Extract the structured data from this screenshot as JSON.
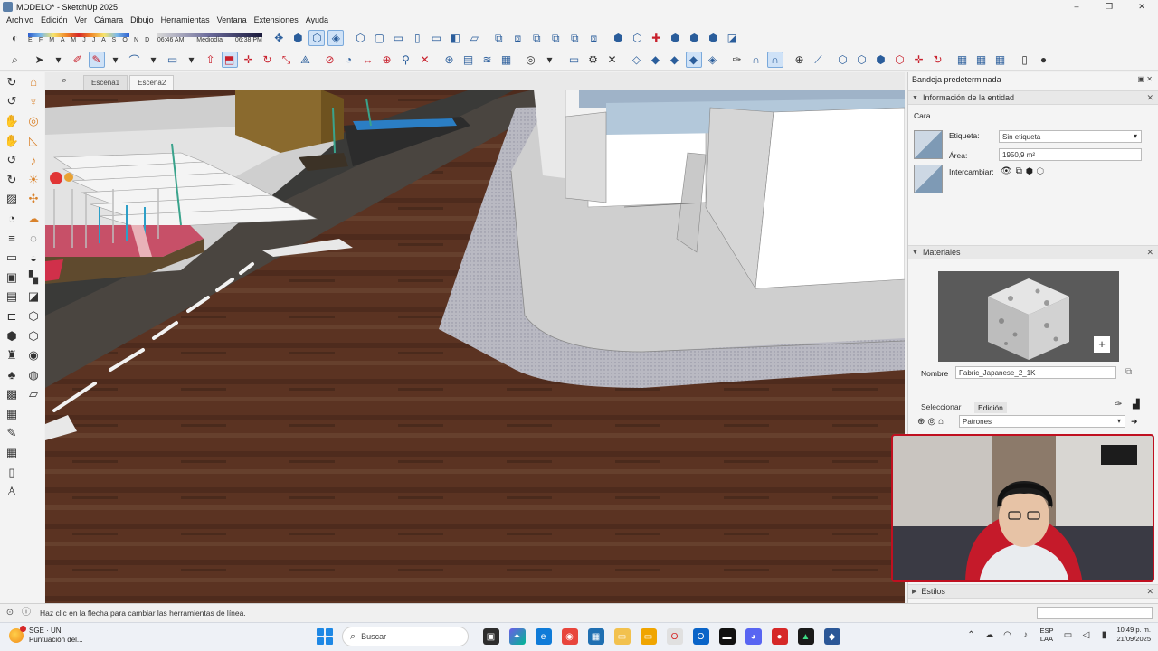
{
  "window": {
    "title": "MODELO* - SketchUp 2025",
    "controls": [
      "–",
      "❐",
      "✕"
    ]
  },
  "menu": [
    "Archivo",
    "Edición",
    "Ver",
    "Cámara",
    "Dibujo",
    "Herramientas",
    "Ventana",
    "Extensiones",
    "Ayuda"
  ],
  "shadows": {
    "months": "E F M A M J J A S O N D",
    "time_start": "06:46 AM",
    "time_mid": "Mediodía",
    "time_end": "06:38 PM"
  },
  "scene_tabs": [
    "Escena1",
    "Escena2"
  ],
  "tray": {
    "title": "Bandeja predeterminada",
    "entity_info": {
      "header": "Información de la entidad",
      "type": "Cara",
      "label_caption": "Etiqueta:",
      "label_value": "Sin etiqueta",
      "area_caption": "Área:",
      "area_value": "1950,9 m²",
      "swap_caption": "Intercambiar:"
    },
    "materials": {
      "header": "Materiales",
      "name_caption": "Nombre",
      "name_value": "Fabric_Japanese_2_1K",
      "tab_select": "Seleccionar",
      "tab_edit": "Edición",
      "collection": "Patrones"
    },
    "styles": {
      "header": "Estilos"
    }
  },
  "status": {
    "message": "Haz clic en la flecha para cambiar las herramientas de línea."
  },
  "taskbar": {
    "weather_title": "SGE · UNI",
    "weather_sub": "Puntuación del...",
    "search_placeholder": "Buscar",
    "lang_top": "ESP",
    "lang_bottom": "LAA",
    "time": "10:49 p. m.",
    "date": "21/09/2025"
  },
  "colors": {
    "accent": "#2a5d9b",
    "webcam_border": "#c01020",
    "floor": "#5a3323"
  }
}
